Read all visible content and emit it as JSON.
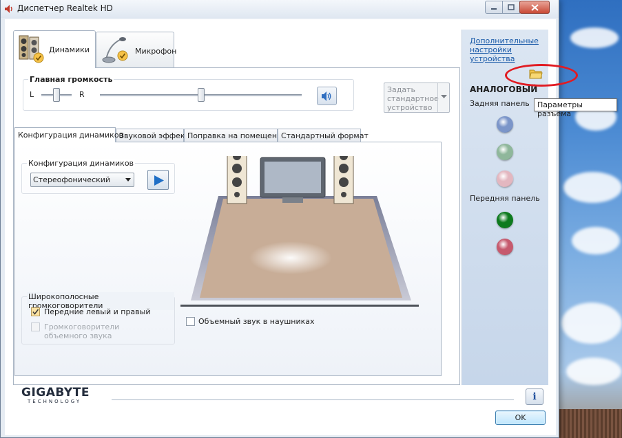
{
  "window": {
    "title": "Диспетчер Realtek HD"
  },
  "main_tabs": [
    {
      "label": "Динамики",
      "icon": "speakers-icon",
      "active": true
    },
    {
      "label": "Микрофон",
      "icon": "microphone-icon",
      "active": false
    }
  ],
  "volume": {
    "title": "Главная громкость",
    "left_label": "L",
    "right_label": "R",
    "balance": 0.5,
    "level": 0.5
  },
  "default_device": {
    "label": "Задать стандартное устройство"
  },
  "sub_tabs": [
    {
      "label": "Конфигурация динамиков",
      "active": true
    },
    {
      "label": "Звуковой эффект",
      "active": false
    },
    {
      "label": "Поправка на помещение",
      "active": false
    },
    {
      "label": "Стандартный формат",
      "active": false
    }
  ],
  "speaker_config": {
    "title": "Конфигурация динамиков",
    "selected": "Стереофонический"
  },
  "wideband": {
    "title": "Широкополосные громкоговорители",
    "front_lr": {
      "label": "Передние левый и правый",
      "checked": true
    },
    "surround": {
      "label": "Громкоговорители объемного звука",
      "checked": false,
      "disabled": true
    }
  },
  "headphones_surround": {
    "label": "Объемный звук в наушниках",
    "checked": false
  },
  "right_panel": {
    "advanced_link": "Дополнительные настройки устройства",
    "analog_title": "АНАЛОГОВЫЙ",
    "rear_label": "Задняя панель",
    "front_label": "Передняя панель",
    "tooltip": "Параметры разъёма",
    "rear_jacks": [
      "#7b95c9",
      "#8fb79b",
      "#e3b7c0"
    ],
    "front_jacks": [
      "#0d7a1e",
      "#c65a6e"
    ]
  },
  "brand": {
    "name": "GIGABYTE",
    "sub": "TECHNOLOGY"
  },
  "buttons": {
    "ok": "OK",
    "info": "i"
  },
  "colors": {
    "accent": "#1a5aa8",
    "annotation": "#e11b22",
    "floor": "#c8ad97"
  }
}
